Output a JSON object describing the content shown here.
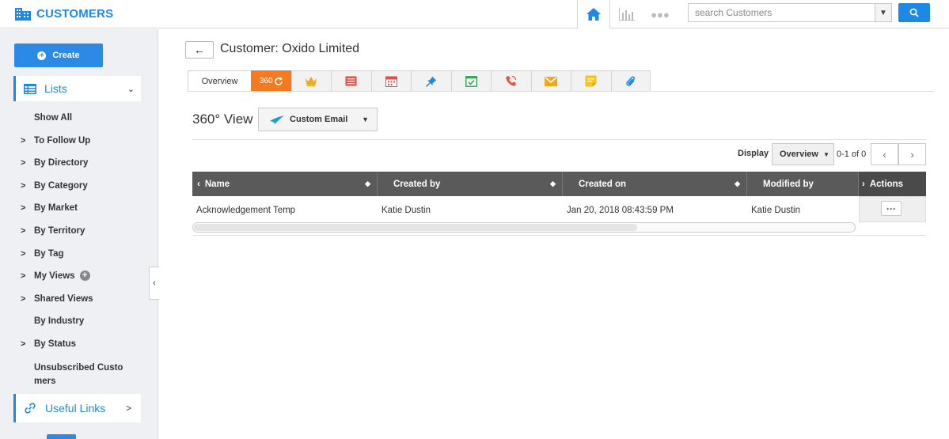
{
  "app": {
    "title": "CUSTOMERS",
    "brand_color": "#1e88e5"
  },
  "topbar": {
    "icons": [
      "home-icon",
      "bar-chart-icon",
      "more-dots-icon"
    ],
    "search": {
      "placeholder": "search Customers",
      "value": ""
    }
  },
  "sidebar": {
    "create_label": "Create",
    "lists_label": "Lists",
    "items": [
      {
        "label": "Show All",
        "arrow": false
      },
      {
        "label": "To Follow Up",
        "arrow": true
      },
      {
        "label": "By Directory",
        "arrow": true
      },
      {
        "label": "By Category",
        "arrow": true
      },
      {
        "label": "By Market",
        "arrow": true
      },
      {
        "label": "By Territory",
        "arrow": true
      },
      {
        "label": "By Tag",
        "arrow": true
      },
      {
        "label": "My Views",
        "arrow": true
      },
      {
        "label": "Shared Views",
        "arrow": true
      },
      {
        "label": "By Industry",
        "arrow": false
      },
      {
        "label": "By Status",
        "arrow": true
      },
      {
        "label": "Unsubscribed Customers",
        "arrow": false
      }
    ],
    "useful_links_label": "Useful Links"
  },
  "main": {
    "title": "Customer: Oxido Limited",
    "tabs": {
      "overview": "Overview",
      "view360": "360",
      "icons": [
        "crown-icon",
        "list-card-icon",
        "calendar-icon",
        "pin-icon",
        "task-check-icon",
        "phone-call-icon",
        "email-icon",
        "note-icon",
        "attachment-icon"
      ]
    },
    "active_color": "#f37a20",
    "view_title": "360° View",
    "email_dropdown": "Custom Email",
    "display_label": "Display",
    "display_value": "Overview",
    "pager_text": "0-1 of 0",
    "table": {
      "columns": [
        "Name",
        "Created by",
        "Created on",
        "Modified by",
        "Actions"
      ],
      "rows": [
        {
          "name": "Acknowledgement Temp",
          "created_by": "Katie Dustin",
          "created_on": "Jan 20, 2018 08:43:59 PM",
          "modified_by": "Katie Dustin"
        }
      ]
    }
  }
}
